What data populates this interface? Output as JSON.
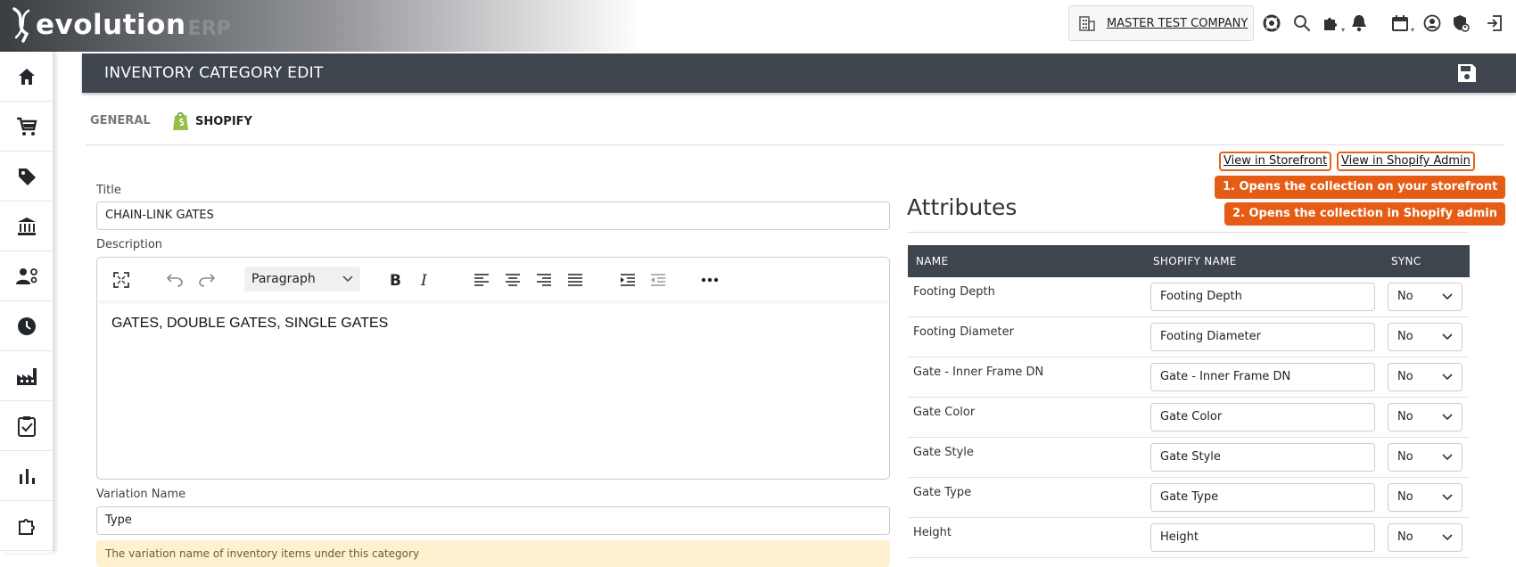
{
  "app": {
    "logo_main": "evolution",
    "logo_sub": "ERP"
  },
  "topbar": {
    "company": "MASTER TEST COMPANY"
  },
  "page": {
    "title": "INVENTORY CATEGORY EDIT"
  },
  "tabs": [
    {
      "label": "GENERAL"
    },
    {
      "label": "SHOPIFY"
    }
  ],
  "form": {
    "title_label": "Title",
    "title_value": "CHAIN-LINK GATES",
    "description_label": "Description",
    "editor": {
      "block_format": "Paragraph",
      "content": "GATES, DOUBLE GATES, SINGLE GATES"
    },
    "variation_label": "Variation Name",
    "variation_value": "Type",
    "help_note": "The variation name of inventory items under this category"
  },
  "links": {
    "storefront": "View in Storefront",
    "admin": "View in Shopify Admin"
  },
  "tips": {
    "tip1": "1. Opens the collection on your storefront",
    "tip2": "2. Opens the collection in Shopify admin"
  },
  "attributes": {
    "title": "Attributes",
    "columns": {
      "name": "NAME",
      "shopify_name": "SHOPIFY NAME",
      "sync": "SYNC"
    },
    "rows": [
      {
        "name": "Footing Depth",
        "shopify_name": "Footing Depth",
        "sync": "No"
      },
      {
        "name": "Footing Diameter",
        "shopify_name": "Footing Diameter",
        "sync": "No"
      },
      {
        "name": "Gate - Inner Frame DN",
        "shopify_name": "Gate - Inner Frame DN",
        "sync": "No"
      },
      {
        "name": "Gate Color",
        "shopify_name": "Gate Color",
        "sync": "No"
      },
      {
        "name": "Gate Style",
        "shopify_name": "Gate Style",
        "sync": "No"
      },
      {
        "name": "Gate Type",
        "shopify_name": "Gate Type",
        "sync": "No"
      },
      {
        "name": "Height",
        "shopify_name": "Height",
        "sync": "No"
      }
    ]
  },
  "colors": {
    "header_bg": "#3f454d",
    "accent_orange": "#e65c14",
    "shopify_green": "#95bf47",
    "note_bg": "#fdf1cf"
  },
  "icons": {
    "sidebar": [
      "home-icon",
      "cart-icon",
      "tag-icon",
      "bank-icon",
      "users-settings-icon",
      "clock-icon",
      "factory-icon",
      "clipboard-check-icon",
      "bar-chart-icon",
      "puzzle-icon"
    ],
    "topbar": [
      "building-icon",
      "lifebuoy-icon",
      "search-icon",
      "puzzle-icon",
      "bell-icon",
      "calendar-icon",
      "user-icon",
      "shield-user-icon",
      "logout-icon"
    ]
  }
}
